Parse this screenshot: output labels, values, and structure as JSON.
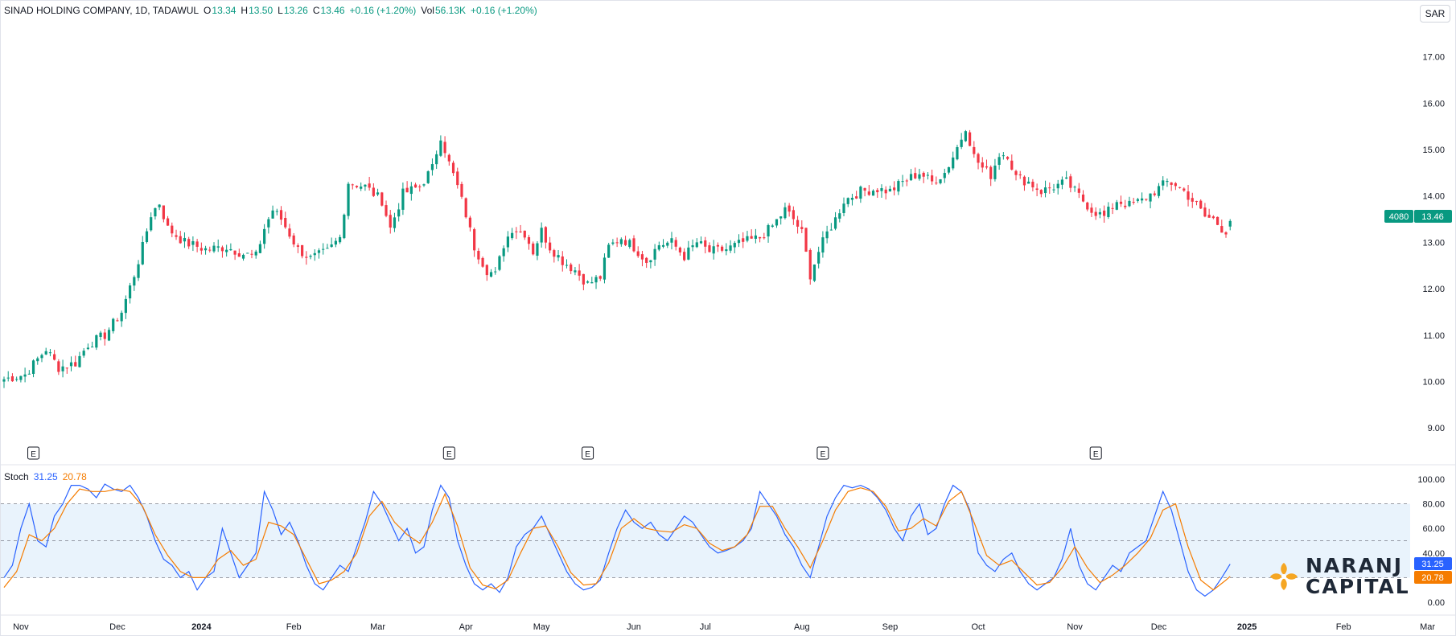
{
  "header": {
    "symbol": "SINAD HOLDING COMPANY, 1D, TADAWUL",
    "open_label": "O",
    "open": "13.34",
    "high_label": "H",
    "high": "13.50",
    "low_label": "L",
    "low": "13.26",
    "close_label": "C",
    "close": "13.46",
    "change": "+0.16 (+1.20%)",
    "vol_label": "Vol",
    "volume": "56.13K",
    "vol_change": "+0.16 (+1.20%)"
  },
  "currency": "SAR",
  "price_tag": {
    "symbol": "4080",
    "value": "13.46"
  },
  "stoch": {
    "label": "Stoch",
    "k_value": "31.25",
    "d_value": "20.78",
    "k_color": "#2962ff",
    "d_color": "#f57c00",
    "levels": [
      "100.00",
      "80.00",
      "60.00",
      "40.00",
      "20.00",
      "0.00"
    ],
    "level_values": [
      100,
      80,
      60,
      40,
      20,
      0
    ],
    "k_tag": "31.25",
    "d_tag": "20.78"
  },
  "colors": {
    "up": "#089981",
    "down": "#f23645",
    "band": "#e3f0fb"
  },
  "logo": {
    "line1": "NARANJ",
    "line2": "CAPITAL",
    "color": "#f5a623"
  },
  "earnings_marker": "E",
  "chart_data": {
    "type": "candlestick",
    "price_axis": {
      "ticks": [
        17,
        16,
        15,
        14,
        13,
        12,
        11,
        10,
        9
      ],
      "tick_labels": [
        "17.00",
        "16.00",
        "15.00",
        "14.00",
        "13.00",
        "12.00",
        "11.00",
        "10.00",
        "9.00"
      ],
      "range": [
        8.5,
        17.6
      ]
    },
    "x_labels": [
      "Nov",
      "Dec",
      "2024",
      "Feb",
      "Mar",
      "Apr",
      "May",
      "Jun",
      "Jul",
      "Aug",
      "Sep",
      "Oct",
      "Nov",
      "Dec",
      "2025",
      "Feb",
      "Mar"
    ],
    "x_label_bars": [
      4,
      27,
      47,
      69,
      89,
      110,
      128,
      150,
      167,
      190,
      211,
      232,
      255,
      275,
      296,
      319,
      339
    ],
    "earnings_bars": [
      7,
      106,
      139,
      195,
      260
    ],
    "close_path": [
      [
        0,
        10.05
      ],
      [
        5,
        10.15
      ],
      [
        10,
        10.7
      ],
      [
        13,
        10.3
      ],
      [
        17,
        10.4
      ],
      [
        20,
        10.8
      ],
      [
        24,
        11.0
      ],
      [
        28,
        11.5
      ],
      [
        31,
        12.3
      ],
      [
        33,
        12.9
      ],
      [
        35,
        13.6
      ],
      [
        37,
        13.85
      ],
      [
        39,
        13.3
      ],
      [
        43,
        13.0
      ],
      [
        48,
        12.85
      ],
      [
        53,
        12.9
      ],
      [
        57,
        12.75
      ],
      [
        60,
        12.7
      ],
      [
        62,
        13.3
      ],
      [
        64,
        13.7
      ],
      [
        66,
        13.5
      ],
      [
        70,
        12.85
      ],
      [
        73,
        12.65
      ],
      [
        77,
        12.8
      ],
      [
        80,
        13.1
      ],
      [
        82,
        14.3
      ],
      [
        86,
        14.2
      ],
      [
        90,
        13.9
      ],
      [
        92,
        13.3
      ],
      [
        95,
        14.05
      ],
      [
        99,
        14.2
      ],
      [
        102,
        14.6
      ],
      [
        104,
        15.3
      ],
      [
        106,
        14.7
      ],
      [
        108,
        14.2
      ],
      [
        110,
        13.6
      ],
      [
        112,
        12.9
      ],
      [
        115,
        12.4
      ],
      [
        117,
        12.3
      ],
      [
        119,
        12.95
      ],
      [
        121,
        13.3
      ],
      [
        124,
        13.2
      ],
      [
        126,
        12.8
      ],
      [
        128,
        13.25
      ],
      [
        130,
        12.9
      ],
      [
        133,
        12.6
      ],
      [
        136,
        12.4
      ],
      [
        139,
        12.1
      ],
      [
        142,
        12.25
      ],
      [
        144,
        12.9
      ],
      [
        147,
        13.1
      ],
      [
        150,
        12.9
      ],
      [
        153,
        12.6
      ],
      [
        156,
        12.95
      ],
      [
        159,
        13.0
      ],
      [
        162,
        12.7
      ],
      [
        165,
        13.0
      ],
      [
        168,
        12.8
      ],
      [
        172,
        12.85
      ],
      [
        176,
        13.0
      ],
      [
        180,
        13.1
      ],
      [
        183,
        13.35
      ],
      [
        186,
        13.7
      ],
      [
        188,
        13.5
      ],
      [
        190,
        13.2
      ],
      [
        192,
        12.3
      ],
      [
        194,
        12.8
      ],
      [
        196,
        13.2
      ],
      [
        198,
        13.5
      ],
      [
        200,
        13.9
      ],
      [
        204,
        14.1
      ],
      [
        208,
        14.15
      ],
      [
        211,
        14.1
      ],
      [
        214,
        14.3
      ],
      [
        218,
        14.5
      ],
      [
        221,
        14.3
      ],
      [
        224,
        14.5
      ],
      [
        226,
        14.85
      ],
      [
        228,
        15.25
      ],
      [
        229,
        15.5
      ],
      [
        231,
        14.85
      ],
      [
        233,
        14.6
      ],
      [
        235,
        14.45
      ],
      [
        237,
        14.9
      ],
      [
        239,
        14.9
      ],
      [
        241,
        14.4
      ],
      [
        244,
        14.3
      ],
      [
        247,
        14.1
      ],
      [
        250,
        14.2
      ],
      [
        253,
        14.3
      ],
      [
        256,
        14.0
      ],
      [
        259,
        13.7
      ],
      [
        262,
        13.55
      ],
      [
        265,
        13.9
      ],
      [
        268,
        13.8
      ],
      [
        271,
        13.9
      ],
      [
        274,
        14.1
      ],
      [
        277,
        14.3
      ],
      [
        279,
        14.25
      ],
      [
        281,
        14.1
      ],
      [
        284,
        13.8
      ],
      [
        286,
        13.55
      ],
      [
        288,
        13.5
      ],
      [
        290,
        13.3
      ],
      [
        291,
        13.25
      ],
      [
        292,
        13.46
      ]
    ],
    "stoch_k_path": [
      [
        0,
        20
      ],
      [
        2,
        30
      ],
      [
        4,
        60
      ],
      [
        6,
        80
      ],
      [
        8,
        50
      ],
      [
        10,
        45
      ],
      [
        12,
        70
      ],
      [
        14,
        80
      ],
      [
        16,
        95
      ],
      [
        18,
        95
      ],
      [
        20,
        92
      ],
      [
        22,
        85
      ],
      [
        24,
        96
      ],
      [
        26,
        92
      ],
      [
        28,
        90
      ],
      [
        30,
        95
      ],
      [
        32,
        85
      ],
      [
        34,
        70
      ],
      [
        36,
        50
      ],
      [
        38,
        35
      ],
      [
        40,
        30
      ],
      [
        42,
        20
      ],
      [
        44,
        25
      ],
      [
        46,
        10
      ],
      [
        48,
        20
      ],
      [
        50,
        25
      ],
      [
        52,
        60
      ],
      [
        54,
        40
      ],
      [
        56,
        20
      ],
      [
        58,
        30
      ],
      [
        60,
        40
      ],
      [
        62,
        90
      ],
      [
        64,
        75
      ],
      [
        66,
        55
      ],
      [
        68,
        65
      ],
      [
        70,
        50
      ],
      [
        72,
        30
      ],
      [
        74,
        15
      ],
      [
        76,
        10
      ],
      [
        78,
        20
      ],
      [
        80,
        30
      ],
      [
        82,
        25
      ],
      [
        84,
        45
      ],
      [
        86,
        65
      ],
      [
        88,
        90
      ],
      [
        90,
        80
      ],
      [
        92,
        65
      ],
      [
        94,
        50
      ],
      [
        96,
        60
      ],
      [
        98,
        40
      ],
      [
        100,
        45
      ],
      [
        102,
        75
      ],
      [
        104,
        95
      ],
      [
        106,
        85
      ],
      [
        108,
        50
      ],
      [
        110,
        30
      ],
      [
        112,
        15
      ],
      [
        114,
        10
      ],
      [
        116,
        15
      ],
      [
        118,
        8
      ],
      [
        120,
        20
      ],
      [
        122,
        45
      ],
      [
        124,
        55
      ],
      [
        126,
        60
      ],
      [
        128,
        70
      ],
      [
        130,
        55
      ],
      [
        132,
        40
      ],
      [
        134,
        25
      ],
      [
        136,
        15
      ],
      [
        138,
        10
      ],
      [
        140,
        12
      ],
      [
        142,
        18
      ],
      [
        144,
        40
      ],
      [
        146,
        60
      ],
      [
        148,
        75
      ],
      [
        150,
        65
      ],
      [
        152,
        60
      ],
      [
        154,
        65
      ],
      [
        156,
        55
      ],
      [
        158,
        50
      ],
      [
        160,
        60
      ],
      [
        162,
        70
      ],
      [
        164,
        65
      ],
      [
        166,
        55
      ],
      [
        168,
        45
      ],
      [
        170,
        40
      ],
      [
        172,
        42
      ],
      [
        174,
        45
      ],
      [
        176,
        50
      ],
      [
        178,
        60
      ],
      [
        180,
        90
      ],
      [
        182,
        80
      ],
      [
        184,
        70
      ],
      [
        186,
        55
      ],
      [
        188,
        45
      ],
      [
        190,
        30
      ],
      [
        192,
        20
      ],
      [
        194,
        45
      ],
      [
        196,
        70
      ],
      [
        198,
        85
      ],
      [
        200,
        95
      ],
      [
        202,
        93
      ],
      [
        204,
        95
      ],
      [
        206,
        92
      ],
      [
        208,
        85
      ],
      [
        210,
        75
      ],
      [
        212,
        60
      ],
      [
        214,
        50
      ],
      [
        216,
        70
      ],
      [
        218,
        80
      ],
      [
        220,
        55
      ],
      [
        222,
        60
      ],
      [
        224,
        80
      ],
      [
        226,
        95
      ],
      [
        228,
        90
      ],
      [
        230,
        75
      ],
      [
        232,
        40
      ],
      [
        234,
        30
      ],
      [
        236,
        25
      ],
      [
        238,
        35
      ],
      [
        240,
        40
      ],
      [
        242,
        25
      ],
      [
        244,
        15
      ],
      [
        246,
        10
      ],
      [
        248,
        15
      ],
      [
        250,
        20
      ],
      [
        252,
        35
      ],
      [
        254,
        60
      ],
      [
        256,
        30
      ],
      [
        258,
        15
      ],
      [
        260,
        10
      ],
      [
        262,
        20
      ],
      [
        264,
        30
      ],
      [
        266,
        25
      ],
      [
        268,
        40
      ],
      [
        270,
        45
      ],
      [
        272,
        50
      ],
      [
        274,
        70
      ],
      [
        276,
        90
      ],
      [
        278,
        75
      ],
      [
        280,
        50
      ],
      [
        282,
        25
      ],
      [
        284,
        10
      ],
      [
        286,
        5
      ],
      [
        288,
        10
      ],
      [
        290,
        20
      ],
      [
        292,
        31
      ]
    ],
    "stoch_d_path": [
      [
        0,
        12
      ],
      [
        3,
        25
      ],
      [
        6,
        55
      ],
      [
        9,
        50
      ],
      [
        12,
        60
      ],
      [
        15,
        80
      ],
      [
        18,
        92
      ],
      [
        21,
        90
      ],
      [
        24,
        90
      ],
      [
        27,
        92
      ],
      [
        30,
        90
      ],
      [
        33,
        78
      ],
      [
        36,
        55
      ],
      [
        39,
        38
      ],
      [
        42,
        25
      ],
      [
        45,
        20
      ],
      [
        48,
        20
      ],
      [
        51,
        35
      ],
      [
        54,
        42
      ],
      [
        57,
        30
      ],
      [
        60,
        35
      ],
      [
        63,
        65
      ],
      [
        66,
        62
      ],
      [
        69,
        55
      ],
      [
        72,
        35
      ],
      [
        75,
        15
      ],
      [
        78,
        18
      ],
      [
        81,
        25
      ],
      [
        84,
        40
      ],
      [
        87,
        70
      ],
      [
        90,
        82
      ],
      [
        93,
        65
      ],
      [
        96,
        55
      ],
      [
        99,
        48
      ],
      [
        102,
        65
      ],
      [
        105,
        88
      ],
      [
        108,
        62
      ],
      [
        111,
        28
      ],
      [
        114,
        14
      ],
      [
        117,
        11
      ],
      [
        120,
        18
      ],
      [
        123,
        40
      ],
      [
        126,
        60
      ],
      [
        129,
        62
      ],
      [
        132,
        45
      ],
      [
        135,
        24
      ],
      [
        138,
        14
      ],
      [
        141,
        15
      ],
      [
        144,
        32
      ],
      [
        147,
        60
      ],
      [
        150,
        68
      ],
      [
        153,
        60
      ],
      [
        156,
        58
      ],
      [
        159,
        57
      ],
      [
        162,
        63
      ],
      [
        165,
        60
      ],
      [
        168,
        48
      ],
      [
        171,
        42
      ],
      [
        174,
        45
      ],
      [
        177,
        55
      ],
      [
        180,
        78
      ],
      [
        183,
        78
      ],
      [
        186,
        60
      ],
      [
        189,
        45
      ],
      [
        192,
        28
      ],
      [
        195,
        50
      ],
      [
        198,
        75
      ],
      [
        201,
        90
      ],
      [
        204,
        93
      ],
      [
        207,
        90
      ],
      [
        210,
        78
      ],
      [
        213,
        58
      ],
      [
        216,
        60
      ],
      [
        219,
        68
      ],
      [
        222,
        62
      ],
      [
        225,
        82
      ],
      [
        228,
        90
      ],
      [
        231,
        65
      ],
      [
        234,
        38
      ],
      [
        237,
        30
      ],
      [
        240,
        34
      ],
      [
        243,
        24
      ],
      [
        246,
        14
      ],
      [
        249,
        16
      ],
      [
        252,
        28
      ],
      [
        255,
        45
      ],
      [
        258,
        28
      ],
      [
        261,
        16
      ],
      [
        264,
        22
      ],
      [
        267,
        30
      ],
      [
        270,
        40
      ],
      [
        273,
        52
      ],
      [
        276,
        75
      ],
      [
        279,
        80
      ],
      [
        282,
        45
      ],
      [
        285,
        18
      ],
      [
        288,
        10
      ],
      [
        291,
        18
      ],
      [
        292,
        21
      ]
    ]
  }
}
